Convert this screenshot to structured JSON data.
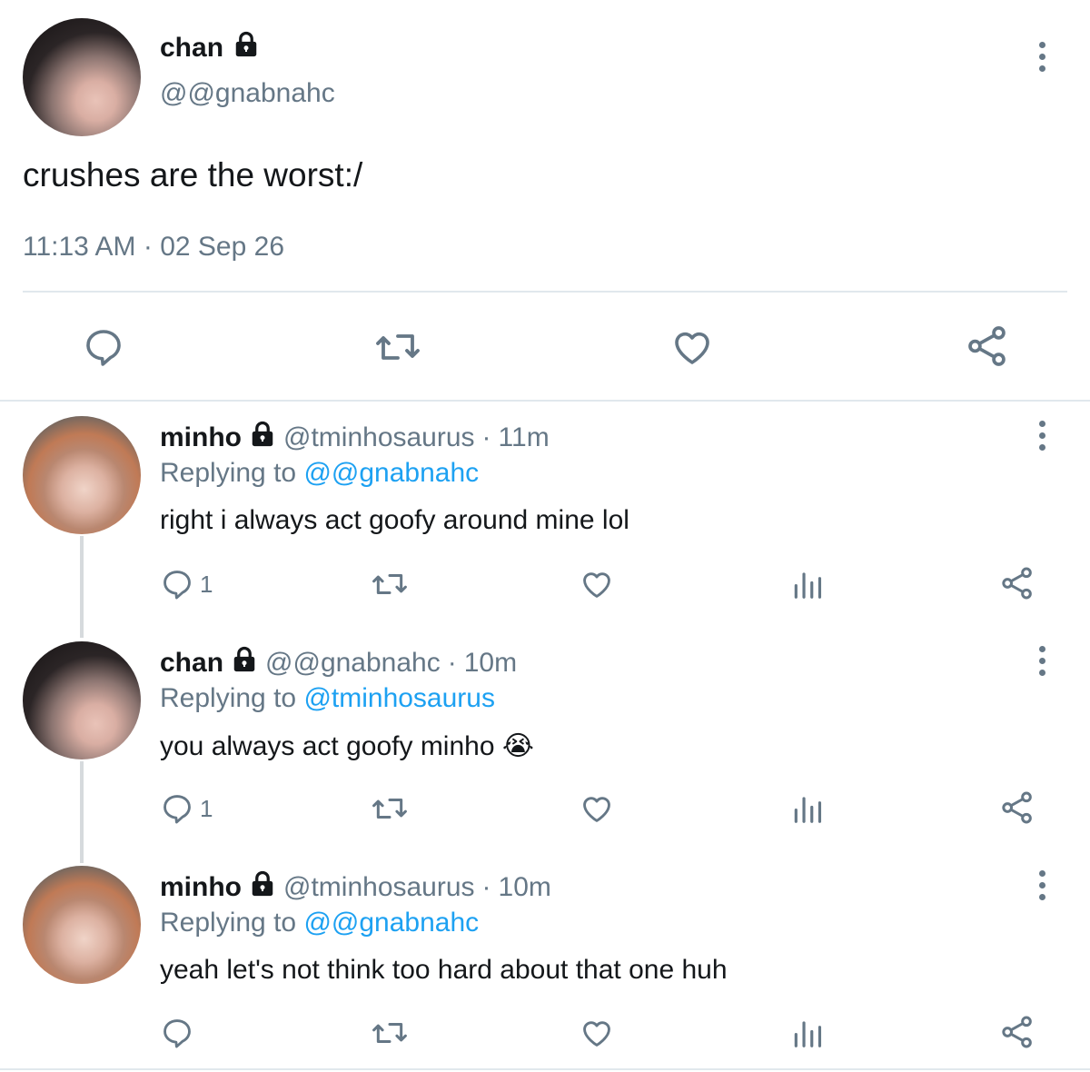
{
  "main_tweet": {
    "display_name": "chan",
    "handle": "@@gnabnahc",
    "text": "crushes are the worst:/",
    "time": "11:13 AM",
    "date": "02 Sep 26"
  },
  "replies": [
    {
      "display_name": "minho",
      "handle": "@tminhosaurus",
      "age": "11m",
      "replying_label": "Replying to",
      "replying_to": "@@gnabnahc",
      "text": "right i always act goofy around mine lol",
      "reply_count": "1"
    },
    {
      "display_name": "chan",
      "handle": "@@gnabnahc",
      "age": "10m",
      "replying_label": "Replying to",
      "replying_to": "@tminhosaurus",
      "text": "you always act goofy minho",
      "emoji": "😭",
      "reply_count": "1"
    },
    {
      "display_name": "minho",
      "handle": "@tminhosaurus",
      "age": "10m",
      "replying_label": "Replying to",
      "replying_to": "@@gnabnahc",
      "text": "yeah let's not think too hard about that one huh",
      "reply_count": ""
    }
  ],
  "separator": "·",
  "icons": {
    "lock": "lock-icon",
    "more": "more-vertical-icon",
    "reply": "comment-icon",
    "retweet": "retweet-icon",
    "like": "heart-icon",
    "analytics": "analytics-icon",
    "share": "share-icon"
  },
  "colors": {
    "text": "#14171a",
    "secondary": "#657786",
    "link": "#1da1f2",
    "divider": "#e1e8ed"
  }
}
